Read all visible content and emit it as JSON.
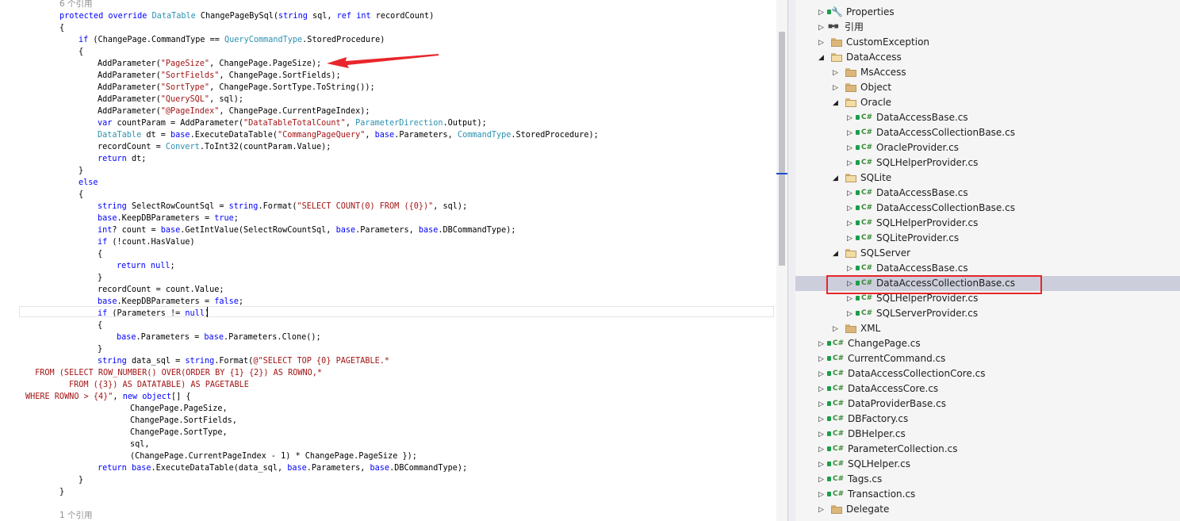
{
  "editor": {
    "lines": [
      [
        {
          "c": "lens",
          "t": "6 个引用"
        }
      ],
      [
        {
          "c": "kw",
          "t": "protected override "
        },
        {
          "c": "ty",
          "t": "DataTable"
        },
        {
          "t": " ChangePageBySql("
        },
        {
          "c": "kw",
          "t": "string"
        },
        {
          "t": " sql, "
        },
        {
          "c": "kw",
          "t": "ref int"
        },
        {
          "t": " recordCount)"
        }
      ],
      [
        {
          "t": "{"
        }
      ],
      [
        {
          "c": "kw",
          "t": "if"
        },
        {
          "t": " (ChangePage.CommandType == "
        },
        {
          "c": "ty",
          "t": "QueryCommandType"
        },
        {
          "t": ".StoredProcedure)"
        }
      ],
      [
        {
          "t": "{"
        }
      ],
      [
        {
          "t": "AddParameter("
        },
        {
          "c": "st",
          "t": "\"PageSize\""
        },
        {
          "t": ", ChangePage.PageSize);"
        }
      ],
      [
        {
          "t": "AddParameter("
        },
        {
          "c": "st",
          "t": "\"SortFields\""
        },
        {
          "t": ", ChangePage.SortFields);"
        }
      ],
      [
        {
          "t": "AddParameter("
        },
        {
          "c": "st",
          "t": "\"SortType\""
        },
        {
          "t": ", ChangePage.SortType.ToString());"
        }
      ],
      [
        {
          "t": "AddParameter("
        },
        {
          "c": "st",
          "t": "\"QuerySQL\""
        },
        {
          "t": ", sql);"
        }
      ],
      [
        {
          "t": "AddParameter("
        },
        {
          "c": "st",
          "t": "\"@PageIndex\""
        },
        {
          "t": ", ChangePage.CurrentPageIndex);"
        }
      ],
      [
        {
          "c": "kw",
          "t": "var"
        },
        {
          "t": " countParam = AddParameter("
        },
        {
          "c": "st",
          "t": "\"DataTableTotalCount\""
        },
        {
          "t": ", "
        },
        {
          "c": "ty",
          "t": "ParameterDirection"
        },
        {
          "t": ".Output);"
        }
      ],
      [
        {
          "c": "ty",
          "t": "DataTable"
        },
        {
          "t": " dt = "
        },
        {
          "c": "kw",
          "t": "base"
        },
        {
          "t": ".ExecuteDataTable("
        },
        {
          "c": "st",
          "t": "\"CommangPageQuery\""
        },
        {
          "t": ", "
        },
        {
          "c": "kw",
          "t": "base"
        },
        {
          "t": ".Parameters, "
        },
        {
          "c": "ty",
          "t": "CommandType"
        },
        {
          "t": ".StoredProcedure);"
        }
      ],
      [
        {
          "t": "recordCount = "
        },
        {
          "c": "ty",
          "t": "Convert"
        },
        {
          "t": ".ToInt32(countParam.Value);"
        }
      ],
      [
        {
          "c": "kw",
          "t": "return"
        },
        {
          "t": " dt;"
        }
      ],
      [
        {
          "t": "}"
        }
      ],
      [
        {
          "c": "kw",
          "t": "else"
        }
      ],
      [
        {
          "t": "{"
        }
      ],
      [
        {
          "c": "kw",
          "t": "string"
        },
        {
          "t": " SelectRowCountSql = "
        },
        {
          "c": "kw",
          "t": "string"
        },
        {
          "t": ".Format("
        },
        {
          "c": "st",
          "t": "\"SELECT COUNT(0) FROM ({0})\""
        },
        {
          "t": ", sql);"
        }
      ],
      [
        {
          "c": "kw",
          "t": "base"
        },
        {
          "t": ".KeepDBParameters = "
        },
        {
          "c": "kw",
          "t": "true"
        },
        {
          "t": ";"
        }
      ],
      [
        {
          "c": "kw",
          "t": "int"
        },
        {
          "t": "? count = "
        },
        {
          "c": "kw",
          "t": "base"
        },
        {
          "t": ".GetIntValue(SelectRowCountSql, "
        },
        {
          "c": "kw",
          "t": "base"
        },
        {
          "t": ".Parameters, "
        },
        {
          "c": "kw",
          "t": "base"
        },
        {
          "t": ".DBCommandType);"
        }
      ],
      [
        {
          "c": "kw",
          "t": "if"
        },
        {
          "t": " (!count.HasValue)"
        }
      ],
      [
        {
          "t": "{"
        }
      ],
      [
        {
          "c": "kw",
          "t": "return null"
        },
        {
          "t": ";"
        }
      ],
      [
        {
          "t": "}"
        }
      ],
      [
        {
          "t": "recordCount = count.Value;"
        }
      ],
      [
        {
          "c": "kw",
          "t": "base"
        },
        {
          "t": ".KeepDBParameters = "
        },
        {
          "c": "kw",
          "t": "false"
        },
        {
          "t": ";"
        }
      ],
      [
        {
          "c": "kw",
          "t": "if"
        },
        {
          "t": " (Parameters != "
        },
        {
          "c": "kw",
          "t": "null"
        },
        {
          "t": ")"
        }
      ],
      [
        {
          "t": "{"
        }
      ],
      [
        {
          "c": "kw",
          "t": "base"
        },
        {
          "t": ".Parameters = "
        },
        {
          "c": "kw",
          "t": "base"
        },
        {
          "t": ".Parameters.Clone();"
        }
      ],
      [
        {
          "t": "}"
        }
      ],
      [
        {
          "c": "kw",
          "t": "string"
        },
        {
          "t": " data_sql = "
        },
        {
          "c": "kw",
          "t": "string"
        },
        {
          "t": ".Format("
        },
        {
          "c": "st",
          "t": "@\"SELECT TOP {0} PAGETABLE.*"
        }
      ],
      [
        {
          "c": "st",
          "t": " FROM (SELECT ROW_NUMBER() OVER(ORDER BY {1} {2}) AS ROWNO,*"
        }
      ],
      [
        {
          "c": "st",
          "t": "FROM ({3}) AS DATATABLE) AS PAGETABLE"
        }
      ],
      [
        {
          "c": "st",
          "t": "WHERE ROWNO > {4}\""
        },
        {
          "t": ", "
        },
        {
          "c": "kw",
          "t": "new object"
        },
        {
          "t": "[] {"
        }
      ],
      [
        {
          "t": "ChangePage.PageSize,"
        }
      ],
      [
        {
          "t": "ChangePage.SortFields,"
        }
      ],
      [
        {
          "t": "ChangePage.SortType,"
        }
      ],
      [
        {
          "t": "sql,"
        }
      ],
      [
        {
          "t": "(ChangePage.CurrentPageIndex - 1) * ChangePage.PageSize });"
        }
      ],
      [
        {
          "c": "kw",
          "t": "return "
        },
        {
          "c": "kw",
          "t": "base"
        },
        {
          "t": ".ExecuteDataTable(data_sql, "
        },
        {
          "c": "kw",
          "t": "base"
        },
        {
          "t": ".Parameters, "
        },
        {
          "c": "kw",
          "t": "base"
        },
        {
          "t": ".DBCommandType);"
        }
      ],
      [
        {
          "t": "}"
        }
      ],
      [
        {
          "t": "}"
        }
      ],
      [],
      [
        {
          "c": "lens",
          "t": "1 个引用"
        }
      ]
    ]
  },
  "solution_explorer": {
    "items": [
      {
        "label": "Properties",
        "icon": "wrench-icon",
        "expander": "collapsed"
      },
      {
        "label": "引用",
        "icon": "references-icon",
        "expander": "collapsed"
      },
      {
        "label": "CustomException",
        "icon": "folder-icon",
        "expander": "collapsed"
      },
      {
        "label": "DataAccess",
        "icon": "folder-open-icon",
        "expander": "expanded"
      },
      {
        "label": "MsAccess",
        "icon": "folder-icon",
        "expander": "collapsed"
      },
      {
        "label": "Object",
        "icon": "folder-icon",
        "expander": "collapsed"
      },
      {
        "label": "Oracle",
        "icon": "folder-open-icon",
        "expander": "expanded"
      },
      {
        "label": "DataAccessBase.cs",
        "icon": "csharp-file-icon",
        "expander": "collapsed"
      },
      {
        "label": "DataAccessCollectionBase.cs",
        "icon": "csharp-file-icon",
        "expander": "collapsed"
      },
      {
        "label": "OracleProvider.cs",
        "icon": "csharp-file-icon",
        "expander": "collapsed"
      },
      {
        "label": "SQLHelperProvider.cs",
        "icon": "csharp-file-icon",
        "expander": "collapsed"
      },
      {
        "label": "SQLite",
        "icon": "folder-open-icon",
        "expander": "expanded"
      },
      {
        "label": "DataAccessBase.cs",
        "icon": "csharp-file-icon",
        "expander": "collapsed"
      },
      {
        "label": "DataAccessCollectionBase.cs",
        "icon": "csharp-file-icon",
        "expander": "collapsed"
      },
      {
        "label": "SQLHelperProvider.cs",
        "icon": "csharp-file-icon",
        "expander": "collapsed"
      },
      {
        "label": "SQLiteProvider.cs",
        "icon": "csharp-file-icon",
        "expander": "collapsed"
      },
      {
        "label": "SQLServer",
        "icon": "folder-open-icon",
        "expander": "expanded"
      },
      {
        "label": "DataAccessBase.cs",
        "icon": "csharp-file-icon",
        "expander": "collapsed"
      },
      {
        "label": "DataAccessCollectionBase.cs",
        "icon": "csharp-file-icon",
        "expander": "collapsed",
        "selected": true
      },
      {
        "label": "SQLHelperProvider.cs",
        "icon": "csharp-file-icon",
        "expander": "collapsed"
      },
      {
        "label": "SQLServerProvider.cs",
        "icon": "csharp-file-icon",
        "expander": "collapsed"
      },
      {
        "label": "XML",
        "icon": "folder-icon",
        "expander": "collapsed"
      },
      {
        "label": "ChangePage.cs",
        "icon": "csharp-file-icon",
        "expander": "collapsed"
      },
      {
        "label": "CurrentCommand.cs",
        "icon": "csharp-file-icon",
        "expander": "collapsed"
      },
      {
        "label": "DataAccessCollectionCore.cs",
        "icon": "csharp-file-icon",
        "expander": "collapsed"
      },
      {
        "label": "DataAccessCore.cs",
        "icon": "csharp-file-icon",
        "expander": "collapsed"
      },
      {
        "label": "DataProviderBase.cs",
        "icon": "csharp-file-icon",
        "expander": "collapsed"
      },
      {
        "label": "DBFactory.cs",
        "icon": "csharp-file-icon",
        "expander": "collapsed"
      },
      {
        "label": "DBHelper.cs",
        "icon": "csharp-file-icon",
        "expander": "collapsed"
      },
      {
        "label": "ParameterCollection.cs",
        "icon": "csharp-file-icon",
        "expander": "collapsed"
      },
      {
        "label": "SQLHelper.cs",
        "icon": "csharp-file-icon",
        "expander": "collapsed"
      },
      {
        "label": "Tags.cs",
        "icon": "csharp-file-icon",
        "expander": "collapsed"
      },
      {
        "label": "Transaction.cs",
        "icon": "csharp-file-icon",
        "expander": "collapsed"
      },
      {
        "label": "Delegate",
        "icon": "folder-icon",
        "expander": "collapsed"
      }
    ]
  },
  "annotations": {
    "arrow_color": "#e8262b",
    "highlight_color": "#e8262b"
  }
}
